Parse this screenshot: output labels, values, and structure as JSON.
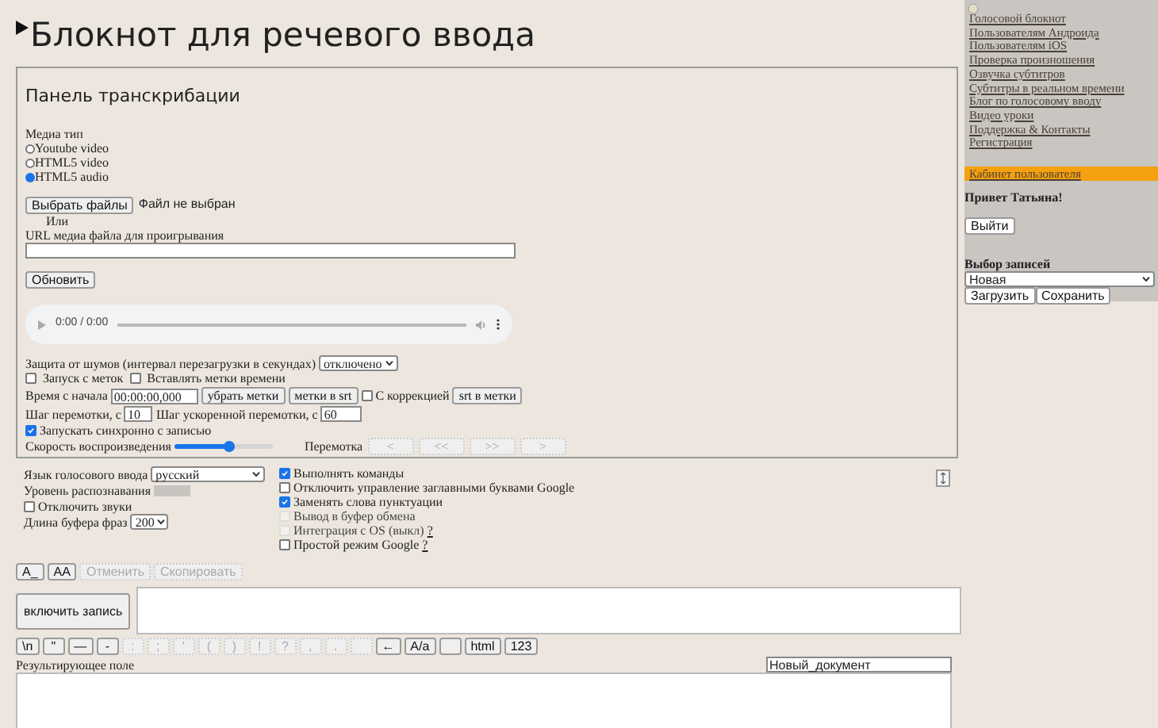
{
  "page_title": "Блокнот для речевого ввода",
  "panel": {
    "title": "Панель транскрибации",
    "media_type_label": "Медиа тип",
    "media_types": [
      {
        "label": "Youtube video",
        "selected": false
      },
      {
        "label": "HTML5 video",
        "selected": false
      },
      {
        "label": "HTML5 audio",
        "selected": true
      }
    ],
    "file_button": "Выбрать файлы",
    "file_status": "Файл не выбран",
    "or_label": "Или",
    "url_label": "URL медиа файла для проигрывания",
    "refresh_button": "Обновить",
    "player_time": "0:00 / 0:00",
    "noise_label": "Защита от шумов (интервал перезагрузки в секундах)",
    "noise_select": "отключено",
    "marks_options": [
      {
        "label": "Запуск с меток",
        "checked": false
      },
      {
        "label": "Вставлять метки времени",
        "checked": false
      }
    ],
    "start_time_label": "Время с начала",
    "start_time": "00:00:00,000",
    "remove_marks_button": "убрать метки",
    "marks_to_srt_button": "метки в srt",
    "correction": {
      "label": "С коррекцией",
      "checked": false
    },
    "srt_to_marks_button": "srt в метки",
    "step_label": "Шаг перемотки, с",
    "step": "10",
    "fast_step_label": "Шаг ускоренной перемотки, с",
    "fast_step": "60",
    "sync": {
      "label": "Запускать синхронно с записью",
      "checked": true
    },
    "speed_label": "Скорость воспроизведения",
    "speed": {
      "level": 0.55
    },
    "rewind_label": "Перемотка",
    "rewind_buttons": [
      "<",
      "<<",
      ">>",
      ">"
    ]
  },
  "settings": {
    "language_label": "Язык голосового ввода",
    "language": "русский",
    "recognition_label": "Уровень распознавания",
    "mute_sounds": {
      "label": "Отключить звуки",
      "checked": false
    },
    "buffer_label": "Длина буфера фраз",
    "buffer": "200"
  },
  "options": [
    {
      "label": "Выполнять команды",
      "checked": true,
      "disabled": false
    },
    {
      "label": "Отключить управление заглавными буквами Google",
      "checked": false,
      "disabled": false
    },
    {
      "label": "Заменять слова пунктуации",
      "checked": true,
      "disabled": false
    },
    {
      "label": "Вывод в буфер обмена",
      "checked": false,
      "disabled": true
    },
    {
      "label": "Интеграция с OS (выкл)",
      "checked": false,
      "disabled": true,
      "help": "?"
    },
    {
      "label": "Простой режим Google",
      "checked": false,
      "disabled": false,
      "help": "?"
    }
  ],
  "toolbar": [
    {
      "label": "A_",
      "disabled": false
    },
    {
      "label": "AA",
      "disabled": false
    },
    {
      "label": "Отменить",
      "disabled": true
    },
    {
      "label": "Скопировать",
      "disabled": true
    }
  ],
  "record_button": "включить запись",
  "keys": [
    {
      "label": "\\n",
      "disabled": false
    },
    {
      "label": "\"",
      "disabled": false
    },
    {
      "label": "—",
      "disabled": false
    },
    {
      "label": "-",
      "disabled": false
    },
    {
      "label": ":",
      "disabled": true
    },
    {
      "label": ";",
      "disabled": true
    },
    {
      "label": "'",
      "disabled": true
    },
    {
      "label": "(",
      "disabled": true
    },
    {
      "label": ")",
      "disabled": true
    },
    {
      "label": "!",
      "disabled": true
    },
    {
      "label": "?",
      "disabled": true
    },
    {
      "label": ",",
      "disabled": true
    },
    {
      "label": ".",
      "disabled": true
    },
    {
      "disabled": true
    },
    {
      "label": "←",
      "disabled": false
    },
    {
      "label": "A/a",
      "disabled": false
    },
    {
      "pressed": true,
      "disabled": false
    },
    {
      "label": "html",
      "disabled": false
    },
    {
      "label": "123",
      "disabled": false
    }
  ],
  "result_label": "Результирующее поле",
  "document_name": "Новый_документ",
  "sidebar": {
    "links": [
      "Голосовой блокнот",
      "Пользователям Андроида",
      "Пользователям iOS",
      "Проверка произношения",
      "Озвучка субтитров",
      "Субтитры в реальном времени",
      "Блог по голосовому вводу",
      "Видео уроки",
      "Поддержка & Контакты",
      "Регистрация"
    ],
    "account_link": "Кабинет пользователя",
    "greeting": "Привет Татьяна!",
    "logout_button": "Выйти",
    "records_label": "Выбор записей",
    "records_select": "Новая",
    "load_button": "Загрузить",
    "save_button": "Сохранить"
  }
}
